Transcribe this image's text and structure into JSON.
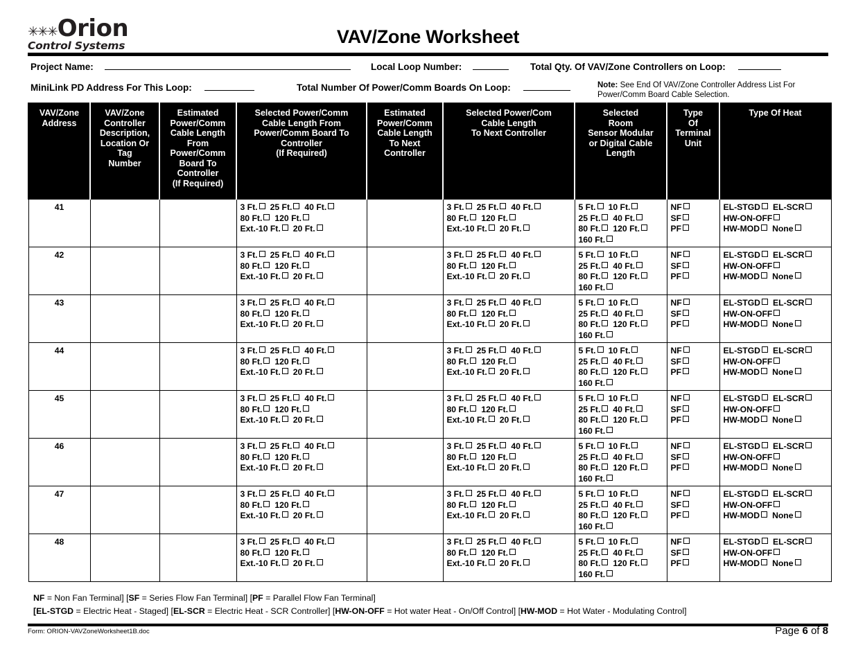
{
  "logo": {
    "stars": [
      "✳",
      "✳",
      "✳"
    ],
    "brand": "Orion",
    "tagline": "Control Systems"
  },
  "header": {
    "title": "VAV/Zone Worksheet",
    "fields": {
      "project_name_label": "Project Name:",
      "project_name_value": "",
      "local_loop_label": "Local Loop Number:",
      "local_loop_value": "",
      "total_qty_label": "Total Qty. Of VAV/Zone Controllers  on Loop:",
      "total_qty_value": "",
      "minilink_label": "MiniLink PD Address For This Loop:",
      "minilink_value": "",
      "total_boards_label": "Total Number Of Power/Comm Boards On Loop:",
      "total_boards_value": ""
    },
    "note_bold": "Note:",
    "note_text": " See End Of VAV/Zone Controller Address List For Power/Comm Board Cable Selection."
  },
  "table": {
    "columns": [
      "VAV/Zone Address",
      "VAV/Zone Controller Description, Location Or Tag Number",
      "Estimated Power/Comm Cable Length From Power/Comm Board To Controller (If Required)",
      "Selected Power/Comm Cable Length From Power/Comm Board To Controller (If Required)",
      "Estimated Power/Comm Cable Length To Next Controller",
      "Selected Power/Com Cable Length To Next Controller",
      "Selected Room Sensor Modular or Digital Cable Length",
      "Type Of Terminal Unit",
      "Type Of Heat"
    ],
    "column_lines": [
      [
        "VAV/Zone",
        "Address"
      ],
      [
        "VAV/Zone",
        "Controller",
        "Description,",
        "Location Or",
        "Tag",
        "Number"
      ],
      [
        "Estimated",
        "Power/Comm",
        "Cable Length",
        "From",
        "Power/Comm",
        "Board To",
        "Controller",
        "(If Required)"
      ],
      [
        "Selected Power/Comm",
        "Cable Length From",
        "Power/Comm Board To",
        "Controller",
        "(If Required)"
      ],
      [
        "Estimated",
        "Power/Comm",
        "Cable Length",
        "To Next",
        "Controller"
      ],
      [
        "Selected Power/Com",
        "Cable Length",
        "To Next Controller"
      ],
      [
        "Selected",
        "Room",
        "Sensor Modular",
        "or Digital Cable",
        "Length"
      ],
      [
        "Type",
        "Of",
        "Terminal",
        "Unit"
      ],
      [
        "Type Of Heat"
      ]
    ],
    "addresses": [
      "41",
      "42",
      "43",
      "44",
      "45",
      "46",
      "47",
      "48"
    ],
    "options": {
      "power_comm_cable": [
        [
          "3 Ft.",
          "25 Ft.",
          "40 Ft."
        ],
        [
          "80 Ft.",
          "120 Ft."
        ],
        [
          "Ext.-10 Ft.",
          "20 Ft."
        ]
      ],
      "room_sensor_cable": [
        [
          "5 Ft.",
          "10 Ft."
        ],
        [
          "25 Ft.",
          "40 Ft."
        ],
        [
          "80 Ft.",
          "120 Ft."
        ],
        [
          "160 Ft."
        ]
      ],
      "terminal_unit": [
        [
          "NF"
        ],
        [
          "SF"
        ],
        [
          "PF"
        ]
      ],
      "type_of_heat": [
        [
          "EL-STGD",
          "EL-SCR"
        ],
        [
          "HW-ON-OFF"
        ],
        [
          "HW-MOD",
          "None"
        ]
      ]
    }
  },
  "legend": {
    "line1": [
      {
        "b": "NF",
        "t": " = Non Fan Terminal] ["
      },
      {
        "b": "SF",
        "t": " = Series Flow Fan Terminal] ["
      },
      {
        "b": "PF",
        "t": " = Parallel Flow Fan Terminal]"
      }
    ],
    "line2": [
      {
        "b": "[EL-STGD",
        "t": " = Electric Heat  - Staged] ["
      },
      {
        "b": "EL-SCR",
        "t": " = Electric Heat  - SCR Controller] ["
      },
      {
        "b": "HW-ON-OFF",
        "t": " = Hot water Heat  - On/Off Control] ["
      },
      {
        "b": "HW-MOD",
        "t": " = Hot Water - Modulating Control]"
      }
    ]
  },
  "footer": {
    "form_id": "Form: ORION-VAVZoneWorksheet1B.doc",
    "page_word": "Page ",
    "page_number": "6",
    "of_word": " of ",
    "page_total": "8"
  }
}
